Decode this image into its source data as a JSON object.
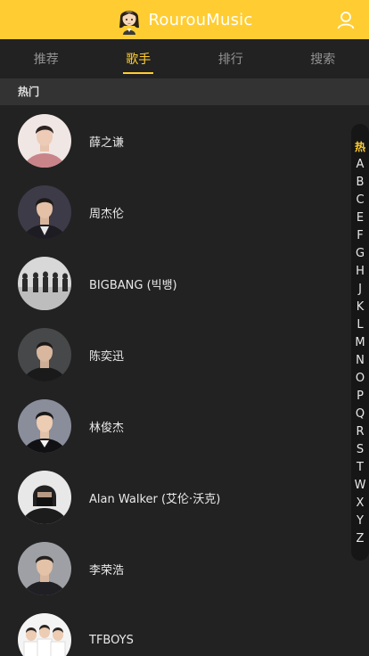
{
  "header": {
    "title": "RourouMusic",
    "logo_icon": "girl-avatar-logo-icon",
    "user_icon": "user-icon",
    "accent_color": "#ffcd32"
  },
  "tabs": [
    {
      "label": "推荐",
      "active": false
    },
    {
      "label": "歌手",
      "active": true
    },
    {
      "label": "排行",
      "active": false
    },
    {
      "label": "搜索",
      "active": false
    }
  ],
  "group": {
    "title": "热门"
  },
  "singers": [
    {
      "name": "薛之谦"
    },
    {
      "name": "周杰伦"
    },
    {
      "name": "BIGBANG (빅뱅)"
    },
    {
      "name": "陈奕迅"
    },
    {
      "name": "林俊杰"
    },
    {
      "name": "Alan Walker (艾伦·沃克)"
    },
    {
      "name": "李荣浩"
    },
    {
      "name": "TFBOYS"
    }
  ],
  "shortcut": {
    "current": "热",
    "items": [
      "热",
      "A",
      "B",
      "C",
      "E",
      "F",
      "G",
      "H",
      "J",
      "K",
      "L",
      "M",
      "N",
      "O",
      "P",
      "Q",
      "R",
      "S",
      "T",
      "W",
      "X",
      "Y",
      "Z"
    ]
  }
}
